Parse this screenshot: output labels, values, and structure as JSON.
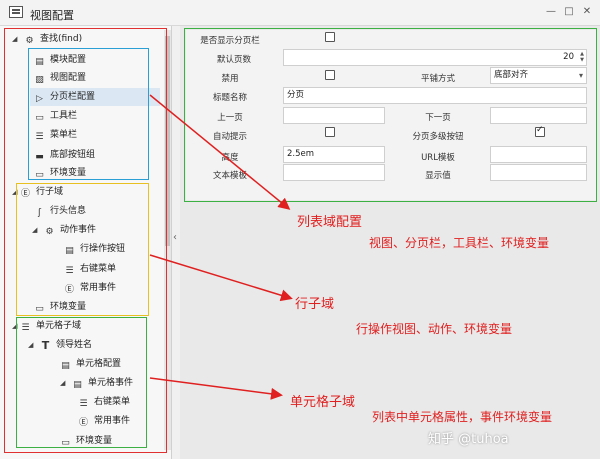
{
  "window": {
    "title": "视图配置",
    "min_glyph": "—",
    "max_glyph": "□",
    "close_glyph": "✕"
  },
  "tree": {
    "root": "查找(find)",
    "items": [
      {
        "label": "模块配置"
      },
      {
        "label": "视图配置"
      },
      {
        "label": "分页栏配置"
      },
      {
        "label": "工具栏"
      },
      {
        "label": "菜单栏"
      },
      {
        "label": "底部按钮组"
      },
      {
        "label": "环境变量"
      },
      {
        "label": "行子域"
      },
      {
        "label": "行头信息"
      },
      {
        "label": "动作事件"
      },
      {
        "label": "行操作按钮"
      },
      {
        "label": "右键菜单"
      },
      {
        "label": "常用事件"
      },
      {
        "label": "环境变量"
      },
      {
        "label": "单元格子域"
      },
      {
        "label": "领导姓名"
      },
      {
        "label": "单元格配置"
      },
      {
        "label": "单元格事件"
      },
      {
        "label": "右键菜单"
      },
      {
        "label": "常用事件"
      },
      {
        "label": "环境变量"
      }
    ]
  },
  "form": {
    "show_pager_label": "是否显示分页栏",
    "default_page_size_label": "默认页数",
    "default_page_size_value": "20",
    "disabled_label": "禁用",
    "tile_mode_label": "平铺方式",
    "tile_mode_value": "底部对齐",
    "title_name_label": "标题名称",
    "title_name_value": "分页",
    "prev_label": "上一页",
    "next_label": "下一页",
    "auto_hint_label": "自动提示",
    "multi_btn_label": "分页多级按钮",
    "height_label": "高度",
    "height_value": "2.5em",
    "url_template_label": "URL模板",
    "text_template_label": "文本模板",
    "display_value_label": "显示值"
  },
  "annotations": {
    "list_domain_title": "列表域配置",
    "list_domain_desc": "视图、分页栏，工具栏、环境变量",
    "row_domain_title": "行子域",
    "row_domain_desc": "行操作视图、动作、环境变量",
    "cell_domain_title": "单元格子域",
    "cell_domain_desc": "列表中单元格属性，事件环境变量"
  },
  "watermark": "知乎 @tuhoa",
  "colors": {
    "red_box": "#e03030",
    "blue_box": "#2a9fd6",
    "yellow_box": "#e8c020",
    "green_box": "#3cb043",
    "annotation": "#e02020"
  }
}
